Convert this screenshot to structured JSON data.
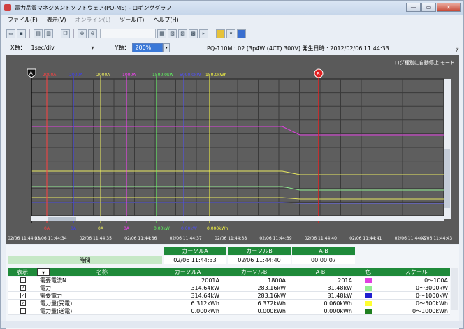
{
  "window": {
    "title": "電力品質マネジメントソフトウェア(PQ-MS) - ロギンググラフ",
    "buttons": {
      "minimize": "—",
      "maximize": "▭",
      "close": "✕"
    }
  },
  "menu": [
    {
      "label": "ファイル(F)",
      "disabled": false
    },
    {
      "label": "表示(V)",
      "disabled": false
    },
    {
      "label": "オンライン(L)",
      "disabled": true
    },
    {
      "label": "ツール(T)",
      "disabled": false
    },
    {
      "label": "ヘルプ(H)",
      "disabled": false
    }
  ],
  "axis": {
    "x_label": "X軸：",
    "x_value": "1sec/div",
    "y_label": "Y軸：",
    "y_value": "200%",
    "device_info": "PQ-110M : 02 [3p4W (4CT) 300V]   発生日時 : 2012/02/06 11:44:33"
  },
  "graph": {
    "mode": "ログ種別に自動停止 モード",
    "cursor_a": "A",
    "cursor_b": "B",
    "top_markers": [
      {
        "label": "2000A",
        "color": "#ff4040"
      },
      {
        "label": "2000A",
        "color": "#3a3aff"
      },
      {
        "label": "2000A",
        "color": "#f0f060"
      },
      {
        "label": "1000A",
        "color": "#ff40ff"
      },
      {
        "label": "1500.0kW",
        "color": "#60ff60"
      },
      {
        "label": "5000.0kW",
        "color": "#5050ff"
      },
      {
        "label": "150.0kWh",
        "color": "#ffff40"
      }
    ],
    "bottom_markers": [
      {
        "label": "0A",
        "color": "#ff4040"
      },
      {
        "label": "0A",
        "color": "#3a3aff"
      },
      {
        "label": "0A",
        "color": "#f0f060"
      },
      {
        "label": "0A",
        "color": "#ff40ff"
      },
      {
        "label": "0.00kW",
        "color": "#60ff60"
      },
      {
        "label": "0.00kW",
        "color": "#5050ff"
      },
      {
        "label": "0.000kWh",
        "color": "#ffff40"
      }
    ],
    "time_labels": [
      "02/06 11:44:33",
      "02/06 11:44:34",
      "02/06 11:44:35",
      "02/06 11:44:36",
      "02/06 11:44:37",
      "02/06 11:44:38",
      "02/06 11:44:39",
      "02/06 11:44:40",
      "02/06 11:44:41",
      "02/06 11:44:42",
      "02/06 11:44:43"
    ]
  },
  "cursor_table": {
    "headers": [
      "カーソルA",
      "カーソルB",
      "A-B"
    ],
    "row_label": "時間",
    "values": [
      "02/06 11:44:33",
      "02/06 11:44:40",
      "00:00:07"
    ]
  },
  "data_table": {
    "headers": {
      "show": "表示",
      "name": "名称",
      "cursor_a": "カーソルA",
      "cursor_b": "カーソルB",
      "diff": "A-B",
      "color": "色",
      "scale": "スケール"
    },
    "rows": [
      {
        "checked": false,
        "name": "需要電流N",
        "a": "2001A",
        "b": "1800A",
        "diff": "201A",
        "color": "#e040e0",
        "scale": "0〜100A"
      },
      {
        "checked": true,
        "name": "電力",
        "a": "314.64kW",
        "b": "283.16kW",
        "diff": "31.48kW",
        "color": "#90ee90",
        "scale": "0〜3000kW"
      },
      {
        "checked": true,
        "name": "需要電力",
        "a": "314.64kW",
        "b": "283.16kW",
        "diff": "31.48kW",
        "color": "#2020d0",
        "scale": "0〜1000kW"
      },
      {
        "checked": true,
        "name": "電力量(受電)",
        "a": "6.312kWh",
        "b": "6.372kWh",
        "diff": "0.060kWh",
        "color": "#ffff30",
        "scale": "0〜500kWh"
      },
      {
        "checked": false,
        "name": "電力量(送電)",
        "a": "0.000kWh",
        "b": "0.000kWh",
        "diff": "0.000kWh",
        "color": "#208020",
        "scale": "0〜1000kWh"
      }
    ]
  }
}
